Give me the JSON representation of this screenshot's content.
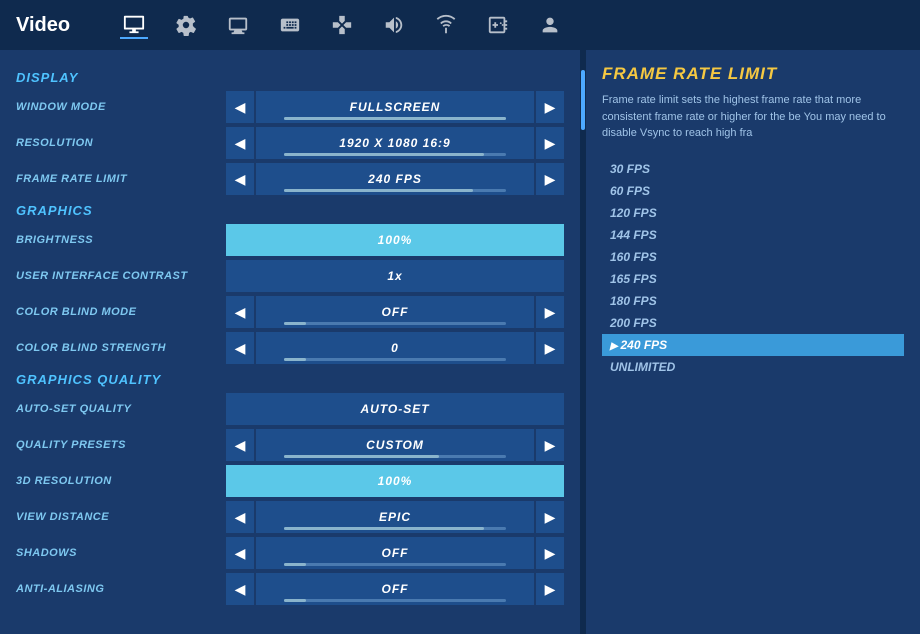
{
  "topBar": {
    "title": "Video",
    "icons": [
      {
        "name": "monitor-icon",
        "symbol": "🖥"
      },
      {
        "name": "gear-icon",
        "symbol": "⚙"
      },
      {
        "name": "display-icon",
        "symbol": "📺"
      },
      {
        "name": "keyboard-icon",
        "symbol": "⌨"
      },
      {
        "name": "controller-icon",
        "symbol": "🎮"
      },
      {
        "name": "audio-icon",
        "symbol": "🔊"
      },
      {
        "name": "network-icon",
        "symbol": "📶"
      },
      {
        "name": "gamepad-icon",
        "symbol": "🕹"
      },
      {
        "name": "user-icon",
        "symbol": "👤"
      }
    ]
  },
  "display": {
    "sectionLabel": "DISPLAY",
    "settings": [
      {
        "label": "WINDOW MODE",
        "value": "FULLSCREEN",
        "hasArrows": true,
        "isHighlighted": false,
        "sliderPercent": 100
      },
      {
        "label": "RESOLUTION",
        "value": "1920 X 1080 16:9",
        "hasArrows": true,
        "isHighlighted": false,
        "sliderPercent": 100
      },
      {
        "label": "FRAME RATE LIMIT",
        "value": "240 FPS",
        "hasArrows": true,
        "isHighlighted": false,
        "sliderPercent": 85
      }
    ]
  },
  "graphics": {
    "sectionLabel": "GRAPHICS",
    "settings": [
      {
        "label": "BRIGHTNESS",
        "value": "100%",
        "hasArrows": false,
        "isBrightness": true
      },
      {
        "label": "USER INTERFACE CONTRAST",
        "value": "1x",
        "hasArrows": false,
        "isHighlighted": false
      },
      {
        "label": "COLOR BLIND MODE",
        "value": "OFF",
        "hasArrows": true,
        "isHighlighted": false,
        "sliderPercent": 10
      },
      {
        "label": "COLOR BLIND STRENGTH",
        "value": "0",
        "hasArrows": true,
        "isHighlighted": false,
        "sliderPercent": 10
      }
    ]
  },
  "graphicsQuality": {
    "sectionLabel": "GRAPHICS QUALITY",
    "settings": [
      {
        "label": "AUTO-SET QUALITY",
        "value": "AUTO-SET",
        "hasArrows": false,
        "isHighlighted": false
      },
      {
        "label": "QUALITY PRESETS",
        "value": "CUSTOM",
        "hasArrows": true,
        "isHighlighted": false,
        "sliderPercent": 70
      },
      {
        "label": "3D RESOLUTION",
        "value": "100%",
        "hasArrows": false,
        "isBrightness": true
      },
      {
        "label": "VIEW DISTANCE",
        "value": "EPIC",
        "hasArrows": true,
        "isHighlighted": false,
        "sliderPercent": 90
      },
      {
        "label": "SHADOWS",
        "value": "OFF",
        "hasArrows": true,
        "isHighlighted": false,
        "sliderPercent": 10
      },
      {
        "label": "ANTI-ALIASING",
        "value": "OFF",
        "hasArrows": true,
        "isHighlighted": false,
        "sliderPercent": 10
      }
    ]
  },
  "rightPanel": {
    "title": "FRAME RATE LIMIT",
    "description": "Frame rate limit sets the highest frame rate that\nmore consistent frame rate or higher for the be\nYou may need to disable Vsync to reach high fra",
    "fpsList": [
      {
        "value": "30 FPS",
        "selected": false
      },
      {
        "value": "60 FPS",
        "selected": false
      },
      {
        "value": "120 FPS",
        "selected": false
      },
      {
        "value": "144 FPS",
        "selected": false
      },
      {
        "value": "160 FPS",
        "selected": false
      },
      {
        "value": "165 FPS",
        "selected": false
      },
      {
        "value": "180 FPS",
        "selected": false
      },
      {
        "value": "200 FPS",
        "selected": false
      },
      {
        "value": "240 FPS",
        "selected": true
      },
      {
        "value": "UNLIMITED",
        "selected": false
      }
    ]
  }
}
